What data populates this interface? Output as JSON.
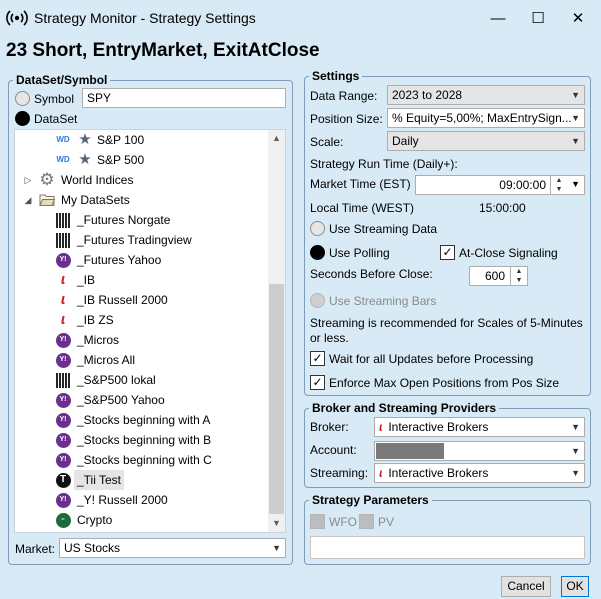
{
  "window": {
    "title": "Strategy Monitor - Strategy Settings",
    "minimize_glyph": "—",
    "maximize_glyph": "☐",
    "close_glyph": "✕"
  },
  "heading": "23 Short, EntryMarket, ExitAtClose",
  "dataset_panel": {
    "title": "DataSet/Symbol",
    "symbol_label": "Symbol",
    "symbol_value": "SPY",
    "dataset_label": "DataSet",
    "selected_mode": "DataSet",
    "tree": [
      {
        "label": "S&P 100",
        "icon": "wd-star-icon"
      },
      {
        "label": "S&P 500",
        "icon": "wd-star-icon"
      },
      {
        "label": "World Indices",
        "icon": "gear-icon",
        "expander": "collapsed"
      },
      {
        "label": "My DataSets",
        "icon": "folder-icon",
        "expander": "expanded"
      },
      {
        "label": "_Futures Norgate",
        "icon": "norgate-icon"
      },
      {
        "label": "_Futures Tradingview",
        "icon": "norgate-icon"
      },
      {
        "label": "_Futures Yahoo",
        "icon": "yahoo-icon"
      },
      {
        "label": "_IB",
        "icon": "ib-icon"
      },
      {
        "label": "_IB Russell 2000",
        "icon": "ib-icon"
      },
      {
        "label": "_IB ZS",
        "icon": "ib-icon"
      },
      {
        "label": "_Micros",
        "icon": "yahoo-icon"
      },
      {
        "label": "_Micros All",
        "icon": "yahoo-icon"
      },
      {
        "label": "_S&P500 lokal",
        "icon": "norgate-icon"
      },
      {
        "label": "_S&P500 Yahoo",
        "icon": "yahoo-icon"
      },
      {
        "label": "_Stocks beginning with A",
        "icon": "yahoo-icon"
      },
      {
        "label": "_Stocks beginning with B",
        "icon": "yahoo-icon"
      },
      {
        "label": "_Stocks beginning with C",
        "icon": "yahoo-icon"
      },
      {
        "label": "_Tii Test",
        "icon": "tii-icon",
        "selected": true
      },
      {
        "label": "_Y! Russell 2000",
        "icon": "yahoo-icon"
      },
      {
        "label": "Crypto",
        "icon": "crypto-icon"
      }
    ],
    "market_label": "Market:",
    "market_value": "US Stocks"
  },
  "settings_panel": {
    "title": "Settings",
    "data_range_label": "Data Range:",
    "data_range_value": "2023 to 2028",
    "position_size_label": "Position Size:",
    "position_size_value": "% Equity=5,00%; MaxEntrySign...",
    "scale_label": "Scale:",
    "scale_value": "Daily",
    "run_time_label": "Strategy Run Time (Daily+):",
    "market_time_label": "Market Time (EST)",
    "market_time_value": "09:00:00",
    "local_time_label": "Local Time (WEST)",
    "local_time_value": "15:00:00",
    "streaming_data_label": "Use Streaming Data",
    "polling_label": "Use Polling",
    "at_close_label": "At-Close Signaling",
    "seconds_before_close_label": "Seconds Before Close:",
    "seconds_before_close_value": "600",
    "streaming_bars_label": "Use Streaming Bars",
    "streaming_note_line1": "Streaming is recommended for Scales of 5-Minutes",
    "streaming_note_line2": "or less.",
    "wait_updates_label": "Wait for all Updates before Processing",
    "enforce_max_label": "Enforce Max Open Positions from Pos Size"
  },
  "broker_panel": {
    "title": "Broker and Streaming Providers",
    "broker_label": "Broker:",
    "broker_value": "Interactive Brokers",
    "account_label": "Account:",
    "streaming_label": "Streaming:",
    "streaming_value": "Interactive Brokers"
  },
  "params_panel": {
    "title": "Strategy Parameters",
    "wfo_label": "WFO",
    "pv_label": "PV"
  },
  "buttons": {
    "cancel": "Cancel",
    "ok": "OK"
  },
  "colors": {
    "background": "#d7eaf5",
    "ib_red": "#d0202a",
    "yahoo_purple": "#6b2f8f",
    "focus_blue": "#0078d7"
  }
}
